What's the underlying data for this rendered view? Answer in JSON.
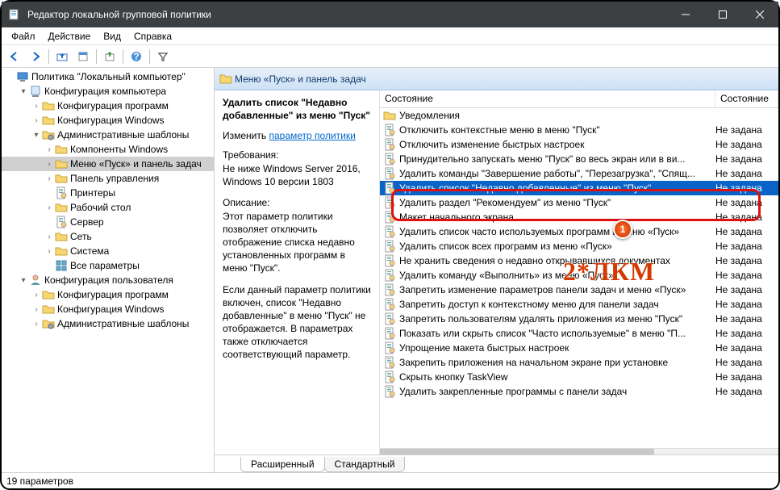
{
  "window": {
    "title": "Редактор локальной групповой политики"
  },
  "menu": [
    "Файл",
    "Действие",
    "Вид",
    "Справка"
  ],
  "tree": {
    "root": "Политика \"Локальный компьютер\"",
    "comp": "Конфигурация компьютера",
    "comp_children": [
      "Конфигурация программ",
      "Конфигурация Windows"
    ],
    "admin": "Административные шаблоны",
    "admin_children": [
      "Компоненты Windows",
      "Меню «Пуск» и панель задач",
      "Панель управления",
      "Принтеры",
      "Рабочий стол",
      "Сервер",
      "Сеть",
      "Система",
      "Все параметры"
    ],
    "user": "Конфигурация пользователя",
    "user_children": [
      "Конфигурация программ",
      "Конфигурация Windows",
      "Административные шаблоны"
    ]
  },
  "category": {
    "title": "Меню «Пуск» и панель задач"
  },
  "desc": {
    "heading": "Удалить список \"Недавно добавленные\" из меню \"Пуск\"",
    "change_label": "Изменить",
    "change_link": "параметр политики",
    "req_label": "Требования:",
    "req_text": "Не ниже Windows Server 2016, Windows 10 версии 1803",
    "desc_label": "Описание:",
    "desc_p1": "Этот параметр политики позволяет отключить отображение списка недавно установленных программ в меню \"Пуск\".",
    "desc_p2": "Если данный параметр политики включен, список \"Недавно добавленные\" в меню \"Пуск\" не отображается.  В параметрах также отключается соответствующий параметр."
  },
  "list": {
    "col_state": "Состояние",
    "folder": "Уведомления",
    "items": [
      {
        "n": "Отключить контекстные меню в меню \"Пуск\"",
        "s": "Не задана"
      },
      {
        "n": "Отключить изменение быстрых настроек",
        "s": "Не задана"
      },
      {
        "n": "Принудительно запускать меню \"Пуск\" во весь экран или в ви...",
        "s": "Не задана"
      },
      {
        "n": "Удалить команды \"Завершение работы\", \"Перезагрузка\", \"Спящ...",
        "s": "Не задана"
      },
      {
        "n": "Удалить список \"Недавно добавленные\" из меню \"Пуск\"",
        "s": "Не задана",
        "sel": true
      },
      {
        "n": "Удалить раздел \"Рекомендуем\" из меню \"Пуск\"",
        "s": "Не задана"
      },
      {
        "n": "Макет начального экрана",
        "s": "Не задана"
      },
      {
        "n": "Удалить список часто используемых программ в меню «Пуск»",
        "s": "Не задана"
      },
      {
        "n": "Удалить список всех программ из меню «Пуск»",
        "s": "Не задана"
      },
      {
        "n": "Не хранить сведения о недавно открывавшихся документах",
        "s": "Не задана"
      },
      {
        "n": "Удалить команду «Выполнить» из меню «Пуск»",
        "s": "Не задана"
      },
      {
        "n": "Запретить изменение параметров панели задач и меню «Пуск»",
        "s": "Не задана"
      },
      {
        "n": "Запретить доступ к контекстному меню для панели задач",
        "s": "Не задана"
      },
      {
        "n": "Запретить пользователям удалять приложения из меню \"Пуск\"",
        "s": "Не задана"
      },
      {
        "n": "Показать или скрыть список \"Часто используемые\" в меню \"П...",
        "s": "Не задана"
      },
      {
        "n": "Упрощение макета быстрых настроек",
        "s": "Не задана"
      },
      {
        "n": "Закрепить приложения на начальном экране при установке",
        "s": "Не задана"
      },
      {
        "n": "Скрыть кнопку TaskView",
        "s": "Не задана"
      },
      {
        "n": "Удалить закрепленные программы с панели задач",
        "s": "Не задана"
      }
    ]
  },
  "tabs": {
    "extended": "Расширенный",
    "standard": "Стандартный"
  },
  "status": "19 параметров",
  "overlay": {
    "label1": "1",
    "text": "2*ЛКМ"
  }
}
